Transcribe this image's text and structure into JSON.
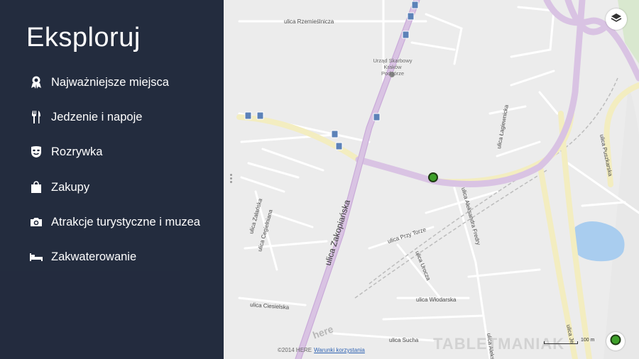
{
  "panel": {
    "title": "Eksploruj",
    "items": [
      {
        "label": "Najważniejsze miejsca",
        "icon": "award-ribbon-icon"
      },
      {
        "label": "Jedzenie i napoje",
        "icon": "fork-knife-icon"
      },
      {
        "label": "Rozrywka",
        "icon": "theater-mask-icon"
      },
      {
        "label": "Zakupy",
        "icon": "shopping-bag-icon"
      },
      {
        "label": "Atrakcje turystyczne i muzea",
        "icon": "camera-icon"
      },
      {
        "label": "Zakwaterowanie",
        "icon": "bed-icon"
      }
    ]
  },
  "map": {
    "streets": {
      "rzemieslnicza": "ulica Rzemieślnicza",
      "zakopianska": "ulica Zakopiańska",
      "lagiewnicka": "ulica Łagiewnicka",
      "puszkarska": "ulica Puszkarska",
      "fredry": "ulica Aleksandra Fredry",
      "przy_torze": "ulica Przy Torze",
      "urocza": "ulica Urocza",
      "wlodarska": "ulica Włodarska",
      "cieselska": "ulica Ciesielska",
      "sucha": "ulica Sucha",
      "cegielniana": "ulica Cegielniana",
      "zaslanska": "ulica Załańska",
      "aleks_bottom": "ulica Aleks",
      "je_bottom": "ulica Je"
    },
    "poi": {
      "urzad_line1": "Urząd Skarbowy",
      "urzad_line2": "Kraków",
      "urzad_line3": "Podgórze"
    },
    "copyright": "©2014 HERE",
    "terms_link": "Warunki korzystania",
    "scale_label": "100 m",
    "watermark": "TABLETMANIAK",
    "here_logo": "here",
    "colors": {
      "panel": "#1c2538",
      "main_road": "#d9c3e3",
      "secondary_road": "#f3edc0",
      "water": "#a9cdef",
      "location_dot": "#3ea02a"
    }
  },
  "controls": {
    "layers": "layers-icon",
    "locate": "location-icon"
  }
}
